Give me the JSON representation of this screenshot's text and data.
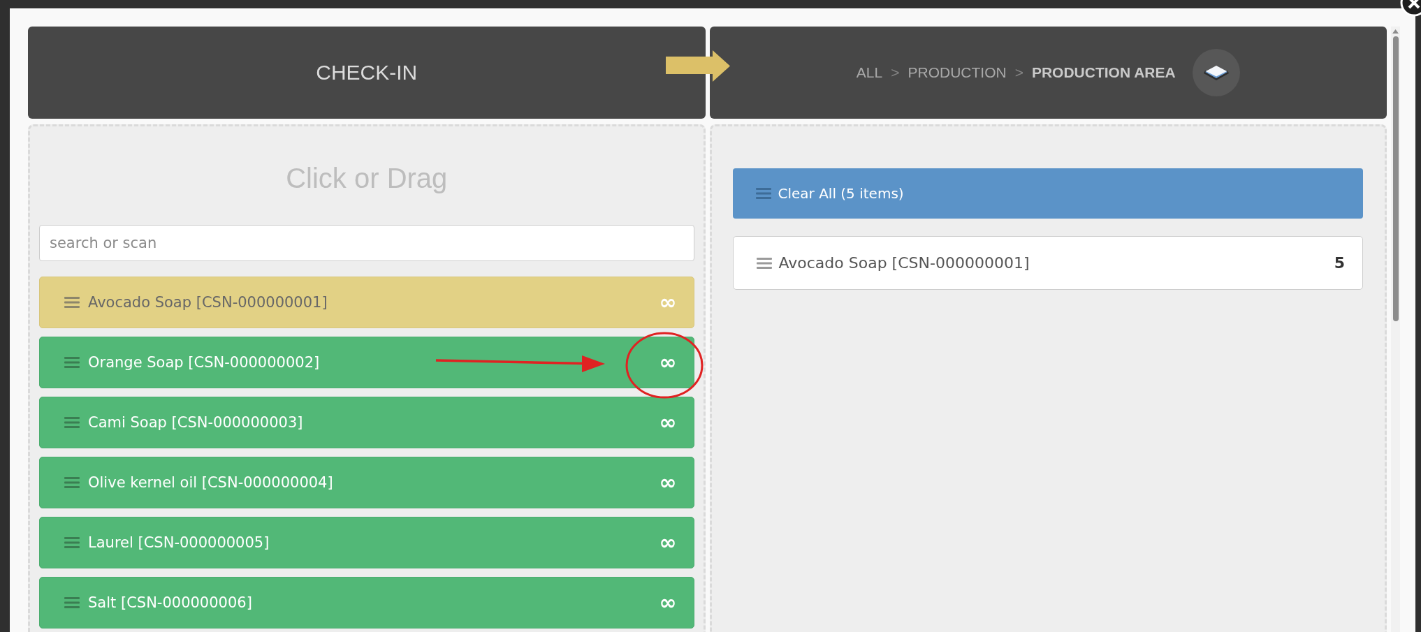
{
  "header": {
    "title": "CHECK-IN"
  },
  "breadcrumb": {
    "items": [
      {
        "label": "ALL",
        "selected": false
      },
      {
        "label": "PRODUCTION",
        "selected": false
      },
      {
        "label": "PRODUCTION AREA",
        "selected": true
      }
    ],
    "separators": [
      ">",
      ">"
    ]
  },
  "source_panel": {
    "title": "Click or Drag",
    "search": {
      "placeholder": "search or scan"
    },
    "items": [
      {
        "name": "Avocado Soap [CSN-000000001]",
        "quantity": "∞",
        "selected": true
      },
      {
        "name": "Orange Soap [CSN-000000002]",
        "quantity": "∞",
        "selected": false
      },
      {
        "name": "Cami Soap [CSN-000000003]",
        "quantity": "∞",
        "selected": false
      },
      {
        "name": "Olive kernel oil [CSN-000000004]",
        "quantity": "∞",
        "selected": false
      },
      {
        "name": "Laurel [CSN-000000005]",
        "quantity": "∞",
        "selected": false
      },
      {
        "name": "Salt [CSN-000000006]",
        "quantity": "∞",
        "selected": false
      }
    ]
  },
  "target_panel": {
    "clear_button": "Clear All (5 items)",
    "items": [
      {
        "name": "Avocado Soap [CSN-000000001]",
        "quantity": "5"
      }
    ]
  }
}
